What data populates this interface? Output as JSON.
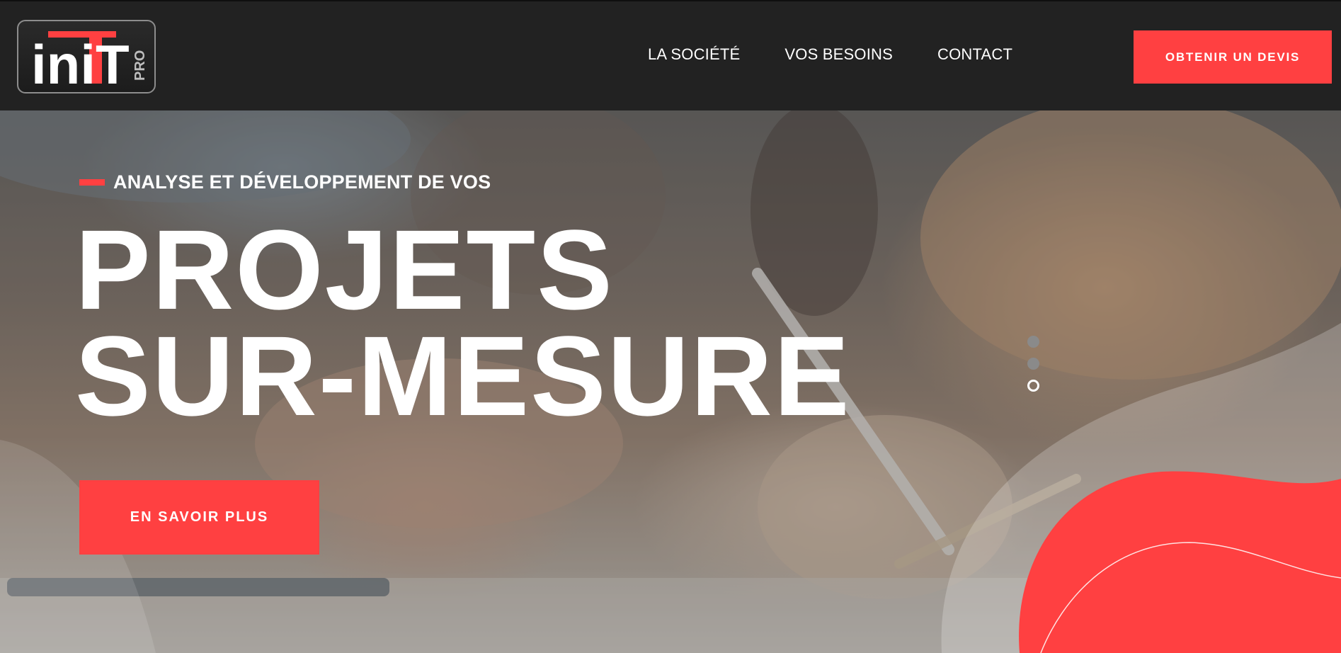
{
  "header": {
    "logo": {
      "text": "iniT",
      "subtext": "PRO",
      "accent_color": "#ff4041"
    },
    "nav": [
      {
        "label": "LA SOCIÉTÉ"
      },
      {
        "label": "VOS BESOINS"
      },
      {
        "label": "CONTACT"
      }
    ],
    "quote_button": "OBTENIR UN DEVIS"
  },
  "hero": {
    "eyebrow": "ANALYSE ET DÉVELOPPEMENT DE VOS",
    "headline_line1": "PROJETS",
    "headline_line2": "SUR-MESURE",
    "cta_button": "EN SAVOIR PLUS",
    "slider": {
      "slides": 3,
      "active_index": 2
    }
  },
  "colors": {
    "accent": "#ff4041",
    "header_bg": "#222222",
    "text": "#ffffff"
  }
}
